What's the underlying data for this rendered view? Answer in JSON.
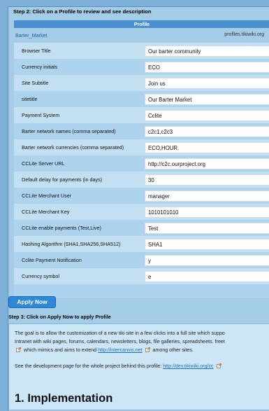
{
  "step2_title": "Step 2: Click on a Profile to review and see description",
  "profile_header": "Profile",
  "profile": {
    "name": "Barter_Market",
    "repository": "profiles.tikiwiki.org"
  },
  "fields": [
    {
      "label": "Browser Title",
      "value": "Our barter community"
    },
    {
      "label": "Currency initials",
      "value": "ECO"
    },
    {
      "label": "Site Subtitle",
      "value": "Join us"
    },
    {
      "label": "sitetitle",
      "value": "Our Barter Market"
    },
    {
      "label": "Payment System",
      "value": "Cclite"
    },
    {
      "label": "Barter network names (comma separated)",
      "value": "c2c1,c2c3"
    },
    {
      "label": "Barter network currencies (comma separated)",
      "value": "ECO,HOUR"
    },
    {
      "label": "CCLite Server URL",
      "value": "http://c2c.ourproject.org"
    },
    {
      "label": "Default delay for payments (in days)",
      "value": "30"
    },
    {
      "label": "CCLite Merchant User",
      "value": "manager"
    },
    {
      "label": "CCLite Merchant Key",
      "value": "1010101010"
    },
    {
      "label": "CCLite enable payments (Test,Live)",
      "value": "Test"
    },
    {
      "label": "Hashing Algorithm (SHA1,SHA256,SHA512)",
      "value": "SHA1"
    },
    {
      "label": "Cclite Payment Notification",
      "value": "y"
    },
    {
      "label": "Currency symbol",
      "value": "e"
    }
  ],
  "apply_button": "Apply Now",
  "step3_title": "Step 3: Click on Apply Now to apply Profile",
  "description": {
    "line1": "The goal is to allow the customization of a new tiki site in a few clicks into a full site which suppo",
    "line2": "Intranet with wiki pages, forums, calendars, newsletters, blogs, file galleries, spreadsheets. freet",
    "line3_pre": "which mimics and aims to extend",
    "line3_link": "http://intercanvis.net",
    "line3_post": "among other sites.",
    "line4_pre": "See the development page for the whole project behind this profile:",
    "line4_link": "http://dev.tikiwiki.org/cc",
    "heading": "1. Implementation"
  },
  "colors": {
    "header_bg": "#4a8fd0",
    "button_bg": "#2f87d8",
    "link": "#1a6fc0"
  },
  "icons": [
    "external-link-icon"
  ]
}
